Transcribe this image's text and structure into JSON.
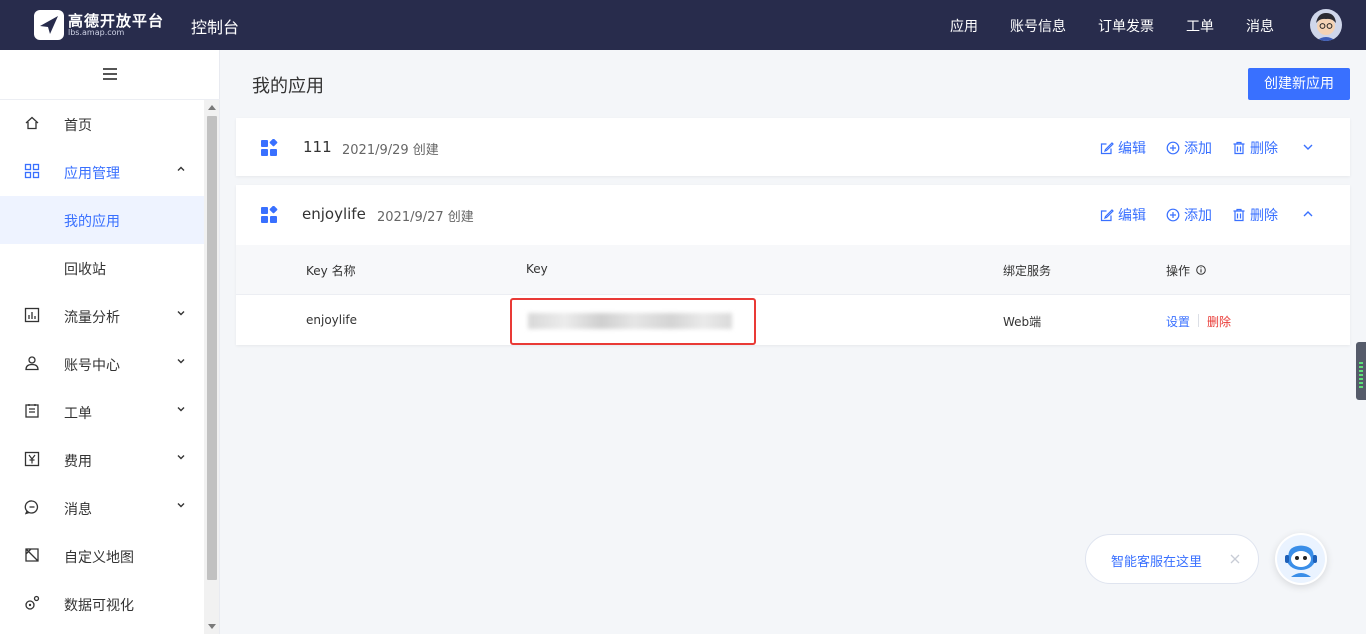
{
  "topbar": {
    "logo_text": "高德开放平台",
    "logo_sub": "lbs.amap.com",
    "console_title": "控制台",
    "nav": [
      "应用",
      "账号信息",
      "订单发票",
      "工单",
      "消息"
    ]
  },
  "sidebar": {
    "items": [
      {
        "label": "首页",
        "icon": "home-icon"
      },
      {
        "label": "应用管理",
        "icon": "grid-icon"
      },
      {
        "label": "我的应用"
      },
      {
        "label": "回收站"
      },
      {
        "label": "流量分析",
        "icon": "chart-icon"
      },
      {
        "label": "账号中心",
        "icon": "user-icon"
      },
      {
        "label": "工单",
        "icon": "ticket-icon"
      },
      {
        "label": "费用",
        "icon": "yen-icon"
      },
      {
        "label": "消息",
        "icon": "message-icon"
      },
      {
        "label": "自定义地图",
        "icon": "map-icon"
      },
      {
        "label": "数据可视化",
        "icon": "visual-icon"
      }
    ]
  },
  "main": {
    "title": "我的应用",
    "create_button": "创建新应用",
    "actions": {
      "edit": "编辑",
      "add": "添加",
      "delete": "删除"
    },
    "apps": [
      {
        "name": "111",
        "date": "2021/9/29 创建",
        "expanded": false
      },
      {
        "name": "enjoylife",
        "date": "2021/9/27 创建",
        "expanded": true,
        "table": {
          "headers": [
            "Key 名称",
            "Key",
            "绑定服务",
            "操作"
          ],
          "rows": [
            {
              "key_name": "enjoylife",
              "service": "Web端",
              "ops": [
                "设置",
                "删除"
              ]
            }
          ]
        }
      }
    ]
  },
  "chat": {
    "label": "智能客服在这里"
  },
  "colors": {
    "accent": "#3970ff",
    "topbar": "#282c4c",
    "danger": "#e93a36"
  }
}
